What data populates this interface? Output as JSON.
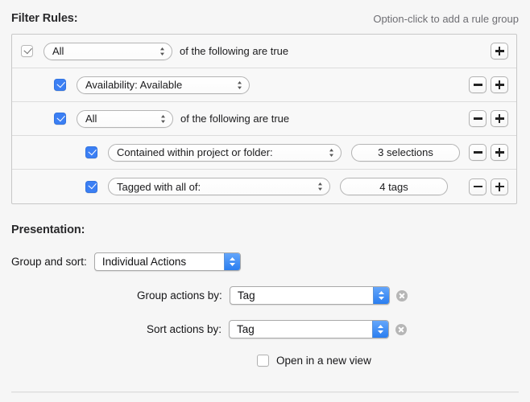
{
  "header": {
    "title": "Filter Rules:",
    "hint": "Option-click to add a rule group"
  },
  "rules": [
    {
      "indent": 0,
      "checkbox": "checked-light",
      "select_label": "All",
      "trailing_text": "of the following are true",
      "value_button": null,
      "buttons": [
        "plus"
      ]
    },
    {
      "indent": 1,
      "checkbox": "checked-blue",
      "select_label": "Availability: Available",
      "trailing_text": "",
      "value_button": null,
      "buttons": [
        "minus",
        "plus"
      ]
    },
    {
      "indent": 1,
      "checkbox": "checked-blue",
      "select_label": "All",
      "trailing_text": "of the following are true",
      "value_button": null,
      "buttons": [
        "minus",
        "plus"
      ]
    },
    {
      "indent": 2,
      "checkbox": "checked-blue",
      "select_label": "Contained within project or folder:",
      "trailing_text": "",
      "value_button": "3 selections",
      "buttons": [
        "minus",
        "plus"
      ]
    },
    {
      "indent": 2,
      "checkbox": "checked-blue",
      "select_label": "Tagged with all of:",
      "trailing_text": "",
      "value_button": "4 tags",
      "buttons": [
        "minus",
        "plus"
      ]
    }
  ],
  "presentation": {
    "title": "Presentation:",
    "group_and_sort": {
      "label": "Group and sort:",
      "value": "Individual Actions"
    },
    "group_actions_by": {
      "label": "Group actions by:",
      "value": "Tag",
      "has_clear": true
    },
    "sort_actions_by": {
      "label": "Sort actions by:",
      "value": "Tag",
      "has_clear": true
    },
    "open_new_view": {
      "label": "Open in a new view",
      "checked": false
    }
  },
  "colors": {
    "accent_blue": "#3b7ff4",
    "popup_blue": "#2a7ef0",
    "window_bg": "#f6f6f6",
    "box_border": "#c8c8c8"
  }
}
